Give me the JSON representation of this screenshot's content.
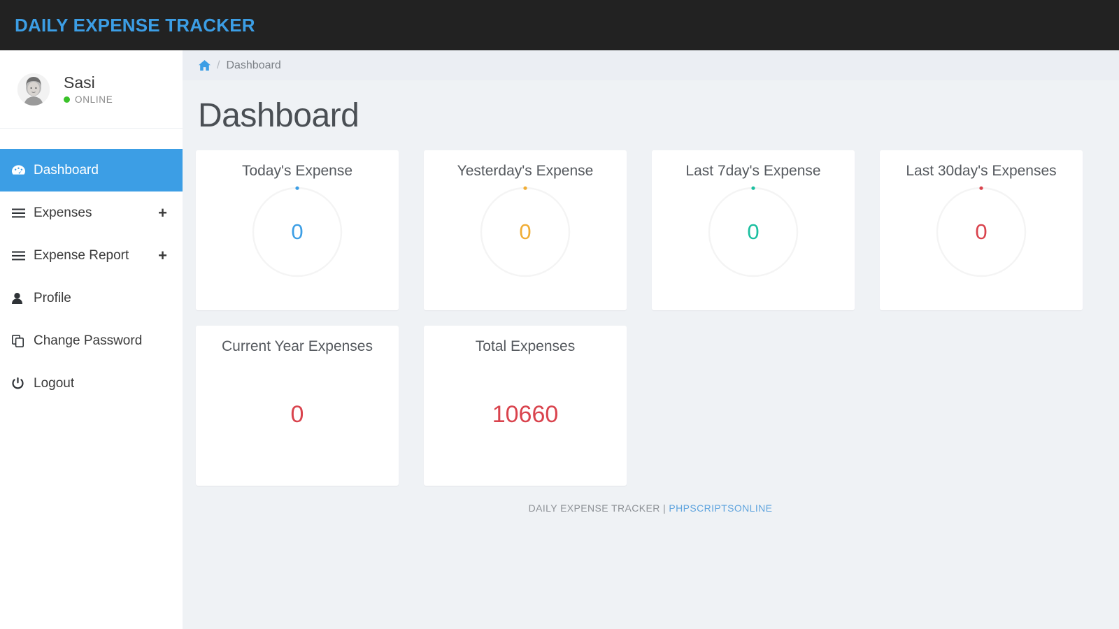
{
  "header": {
    "brand": "DAILY EXPENSE TRACKER"
  },
  "sidebar": {
    "user": {
      "name": "Sasi",
      "status": "ONLINE",
      "avatar_icon": "user-photo-avatar"
    },
    "items": [
      {
        "label": "Dashboard",
        "icon": "tachometer-icon",
        "active": true,
        "expandable": false,
        "plus": ""
      },
      {
        "label": "Expenses",
        "icon": "bars-icon",
        "active": false,
        "expandable": true,
        "plus": "+"
      },
      {
        "label": "Expense Report",
        "icon": "bars-icon",
        "active": false,
        "expandable": true,
        "plus": "+"
      },
      {
        "label": "Profile",
        "icon": "user-icon",
        "active": false,
        "expandable": false,
        "plus": ""
      },
      {
        "label": "Change Password",
        "icon": "copy-icon",
        "active": false,
        "expandable": false,
        "plus": ""
      },
      {
        "label": "Logout",
        "icon": "power-off-icon",
        "active": false,
        "expandable": false,
        "plus": ""
      }
    ]
  },
  "breadcrumb": {
    "home_icon": "home-icon",
    "separator": "/",
    "current": "Dashboard"
  },
  "main": {
    "title": "Dashboard",
    "cards": [
      {
        "title": "Today's Expense",
        "value": "0",
        "color": "#3c9ee5",
        "gauge": true,
        "percent": 0
      },
      {
        "title": "Yesterday's Expense",
        "value": "0",
        "color": "#f0ad35",
        "gauge": true,
        "percent": 0
      },
      {
        "title": "Last 7day's Expense",
        "value": "0",
        "color": "#1bbfa0",
        "gauge": true,
        "percent": 0
      },
      {
        "title": "Last 30day's Expenses",
        "value": "0",
        "color": "#d9434d",
        "gauge": true,
        "percent": 0
      },
      {
        "title": "Current Year Expenses",
        "value": "0",
        "color": "#d9434d",
        "gauge": false,
        "percent": 0
      },
      {
        "title": "Total Expenses",
        "value": "10660",
        "color": "#d9434d",
        "gauge": false,
        "percent": 0
      }
    ]
  },
  "footer": {
    "text": "DAILY EXPENSE TRACKER |",
    "link": "PHPSCRIPTSONLINE"
  },
  "colors": {
    "topbar_bg": "#222222",
    "brand": "#3c9ee5",
    "accent": "#3c9ee5",
    "content_bg": "#eff2f5",
    "breadcrumb_bg": "#ebeef3",
    "sidebar_bg": "#ffffff",
    "online": "#3ac229"
  }
}
